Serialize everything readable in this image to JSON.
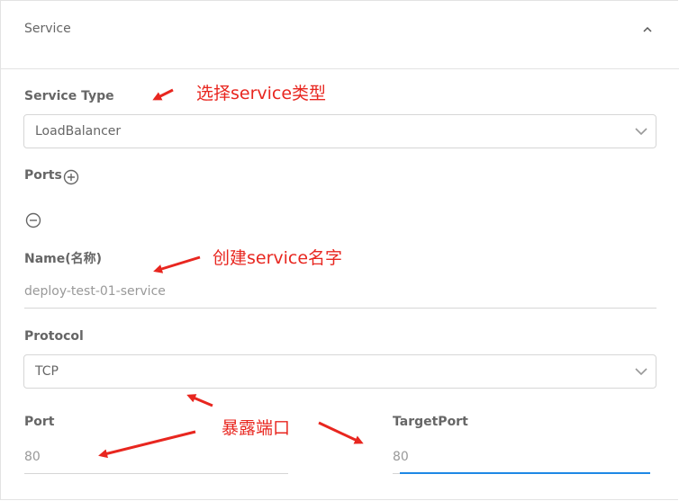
{
  "section": {
    "title": "Service"
  },
  "service_type": {
    "label": "Service Type",
    "value": "LoadBalancer"
  },
  "ports": {
    "label": "Ports"
  },
  "name": {
    "label": "Name(名称)",
    "value": "deploy-test-01-service"
  },
  "protocol": {
    "label": "Protocol",
    "value": "TCP"
  },
  "port": {
    "label": "Port",
    "value": "80"
  },
  "target_port": {
    "label": "TargetPort",
    "value": "80"
  },
  "annotations": {
    "service_type_note": "选择service类型",
    "name_note": "创建service名字",
    "port_note": "暴露端口"
  },
  "colors": {
    "annotation": "#e8261f",
    "focus_underline": "#1e88e5"
  }
}
